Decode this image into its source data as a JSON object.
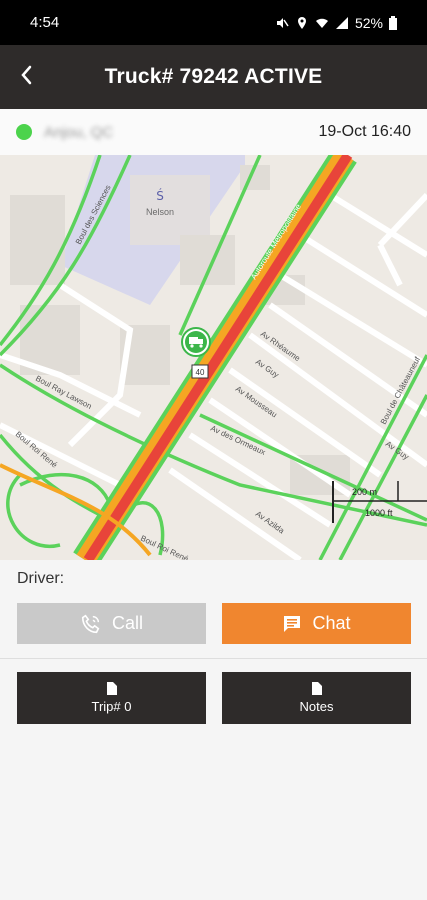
{
  "status_bar": {
    "time": "4:54",
    "battery_text": "52%",
    "icons": [
      "mute-icon",
      "location-icon",
      "wifi-icon",
      "signal-icon",
      "battery-icon"
    ]
  },
  "header": {
    "title": "Truck# 79242 ACTIVE",
    "back_icon": "back-chevron-icon"
  },
  "location_row": {
    "status_color": "#4cd34c",
    "location_text": "Anjou, QC",
    "datetime": "19-Oct 16:40"
  },
  "map": {
    "place_label": "Nelson",
    "streets": [
      "Boul des Sciences",
      "Autoroute Métropolitaine",
      "Av Rhéaume",
      "Av Guy",
      "Av Mousseau",
      "Av des Ormeaux",
      "Boul Ray Lawson",
      "Boul Roi René",
      "Av Azilda",
      "Boul de Châteauneuf",
      "Av Guy",
      "Boul Roi René"
    ],
    "shield_label": "40",
    "scale_metric": "200 m",
    "scale_imperial": "1000 ft"
  },
  "driver": {
    "label": "Driver:"
  },
  "actions": {
    "call_label": "Call",
    "chat_label": "Chat"
  },
  "tiles": {
    "trip_label": "Trip# 0",
    "notes_label": "Notes"
  },
  "colors": {
    "appbar": "#2e2b2a",
    "accent": "#f0862f",
    "disabled": "#c9c9c9",
    "traffic_green": "#5bd25b",
    "traffic_red": "#e8443a",
    "traffic_orange": "#f5a623"
  }
}
